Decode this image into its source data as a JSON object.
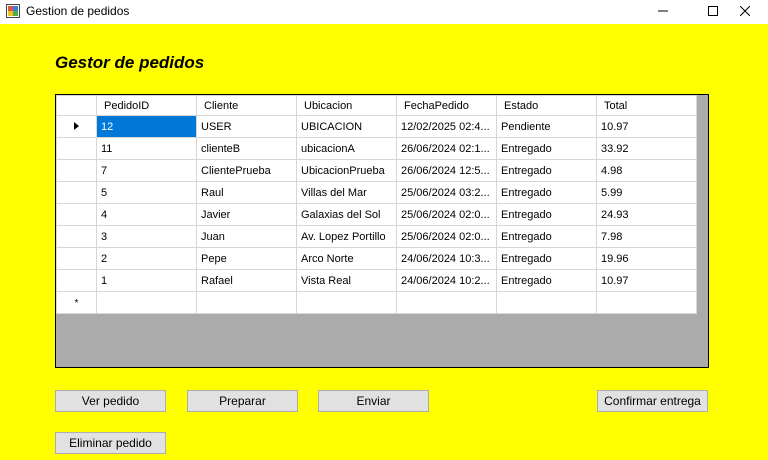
{
  "window": {
    "title": "Gestion de pedidos",
    "minimize": "—",
    "maximize": "☐",
    "close": "✕"
  },
  "heading": "Gestor de pedidos",
  "grid": {
    "columns": [
      "PedidoID",
      "Cliente",
      "Ubicacion",
      "FechaPedido",
      "Estado",
      "Total"
    ],
    "rows": [
      [
        "12",
        "USER",
        "UBICACION",
        "12/02/2025 02:4...",
        "Pendiente",
        "10.97"
      ],
      [
        "11",
        "clienteB",
        "ubicacionA",
        "26/06/2024 02:1...",
        "Entregado",
        "33.92"
      ],
      [
        "7",
        "ClientePrueba",
        "UbicacionPrueba",
        "26/06/2024 12:5...",
        "Entregado",
        "4.98"
      ],
      [
        "5",
        "Raul",
        "Villas del Mar",
        "25/06/2024 03:2...",
        "Entregado",
        "5.99"
      ],
      [
        "4",
        "Javier",
        "Galaxias del Sol",
        "25/06/2024 02:0...",
        "Entregado",
        "24.93"
      ],
      [
        "3",
        "Juan",
        "Av. Lopez Portillo",
        "25/06/2024 02:0...",
        "Entregado",
        "7.98"
      ],
      [
        "2",
        "Pepe",
        "Arco Norte",
        "24/06/2024 10:3...",
        "Entregado",
        "19.96"
      ],
      [
        "1",
        "Rafael",
        "Vista Real",
        "24/06/2024 10:2...",
        "Entregado",
        "10.97"
      ]
    ],
    "new_row_marker": "*",
    "selected_row": 0
  },
  "buttons": {
    "ver_pedido": "Ver pedido",
    "preparar": "Preparar",
    "enviar": "Enviar",
    "confirmar_entrega": "Confirmar entrega",
    "eliminar_pedido": "Eliminar pedido"
  },
  "colors": {
    "background": "#ffff00",
    "selection": "#0078d7",
    "grid_background": "#ababab"
  }
}
